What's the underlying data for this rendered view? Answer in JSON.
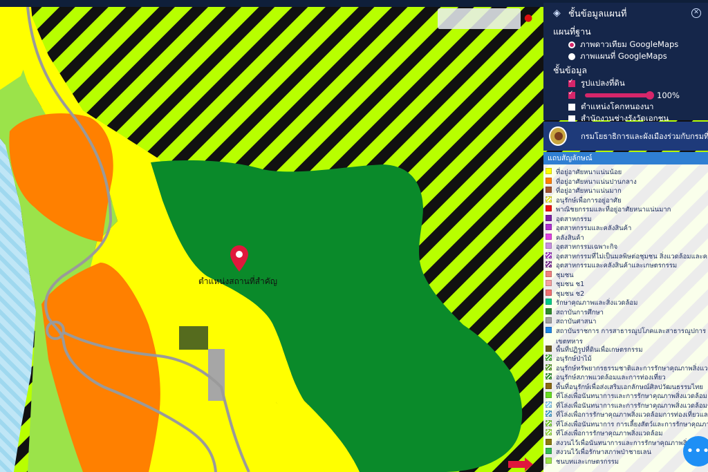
{
  "map": {
    "place_label": "ตำแหน่งสถานที่สำคัญ",
    "colors": {
      "hatch_green": "#b8ff00",
      "hatch_black": "#111111",
      "yellow": "#ffff00",
      "orange": "#ff8000",
      "dark_green": "#0a8a2a",
      "olive": "#556b1e",
      "gray": "#a6a6a6",
      "light_blue": "#9fd8ef",
      "marker": "#e0183c"
    }
  },
  "layer_panel": {
    "title": "ชั้นข้อมูลแผนที่",
    "base_section": "แผนที่ฐาน",
    "base_options": [
      {
        "label": "ภาพดาวเทียม GoogleMaps",
        "selected": true
      },
      {
        "label": "ภาพแผนที่ GoogleMaps",
        "selected": false
      }
    ],
    "layer_section": "ชั้นข้อมูล",
    "layers": [
      {
        "label": "รูปแปลงที่ดิน",
        "checked": true
      },
      {
        "label": "",
        "checked": true,
        "opacity": "100%"
      },
      {
        "label": "ตำแหน่งโคกหนองนา",
        "checked": false
      },
      {
        "label": "สำนักงานช่างรังวัดเอกชน",
        "checked": false
      }
    ]
  },
  "agency": {
    "text": "กรมโยธาธิการและผังเมืองร่วมกับกรมที่ดิน"
  },
  "legend": {
    "title": "แถบสัญลักษณ์",
    "items": [
      {
        "label": "ที่อยู่อาศัยหนาแน่นน้อย",
        "color": "#ffff00",
        "pattern": "solid"
      },
      {
        "label": "ที่อยู่อาศัยหนาแน่นปานกลาง",
        "color": "#ff8000",
        "pattern": "solid"
      },
      {
        "label": "ที่อยู่อาศัยหนาแน่นมาก",
        "color": "#a0522d",
        "pattern": "solid"
      },
      {
        "label": "อนุรักษ์เพื่อการอยู่อาศัย",
        "color": "#e6e620",
        "pattern": "hatch"
      },
      {
        "label": "พาณิชยกรรมและที่อยู่อาศัยหนาแน่นมาก",
        "color": "#ee1111",
        "pattern": "solid"
      },
      {
        "label": "อุตสาหกรรม",
        "color": "#7a1fa2",
        "pattern": "solid"
      },
      {
        "label": "อุตสาหกรรมและคลังสินค้า",
        "color": "#b030d0",
        "pattern": "solid"
      },
      {
        "label": "คลังสินค้า",
        "color": "#e040e0",
        "pattern": "solid"
      },
      {
        "label": "อุตสาหกรรมเฉพาะกิจ",
        "color": "#c890e0",
        "pattern": "solid"
      },
      {
        "label": "อุตสาหกรรมที่ไม่เป็นมลพิษต่อชุมชน สิ่งแวดล้อมและคลังสินค้า",
        "color": "#9b30c0",
        "pattern": "hatch"
      },
      {
        "label": "อุตสาหกรรมและคลังสินค้าและเกษตรกรรม",
        "color": "#7a2a90",
        "pattern": "hatch"
      },
      {
        "label": "ชุมชน",
        "color": "#f08080",
        "pattern": "solid"
      },
      {
        "label": "ชุมชน ช1",
        "color": "#f5a0a0",
        "pattern": "solid"
      },
      {
        "label": "ชุมชน ช2",
        "color": "#f07070",
        "pattern": "solid"
      },
      {
        "label": "รักษาคุณภาพและสิ่งแวดล้อม",
        "color": "#00cc88",
        "pattern": "solid"
      },
      {
        "label": "สถาบันการศึกษา",
        "color": "#2e8b2e",
        "pattern": "solid"
      },
      {
        "label": "สถาบันศาสนา",
        "color": "#a0a0a0",
        "pattern": "solid"
      },
      {
        "label": "สถาบันราชการ การสาธารณูปโภคและสาธารณูปการ เขตทหาร",
        "color": "#1e88e5",
        "pattern": "solid"
      },
      {
        "label": "พื้นที่ปฏิรูปที่ดินเพื่อเกษตรกรรม",
        "color": "#6b5a1e",
        "pattern": "solid"
      },
      {
        "label": "อนุรักษ์ป่าไม้",
        "color": "#40b030",
        "pattern": "hatch"
      },
      {
        "label": "อนุรักษ์ทรัพยากรธรรมชาติและการรักษาคุณภาพสิ่งแวดล้อม",
        "color": "#5aa02a",
        "pattern": "hatch"
      },
      {
        "label": "อนุรักษ์สภาพแวดล้อมและการท่องเที่ยว",
        "color": "#2f8f2f",
        "pattern": "hatch"
      },
      {
        "label": "พื้นที่อนุรักษ์เพื่อส่งเสริมเอกลักษณ์ศิลปวัฒนธรรมไทย",
        "color": "#8a6a10",
        "pattern": "solid"
      },
      {
        "label": "ที่โล่งเพื่อนันทนาการและการรักษาคุณภาพสิ่งแวดล้อม",
        "color": "#66dd22",
        "pattern": "solid"
      },
      {
        "label": "ที่โล่งเพื่อนันทนาการและการรักษาคุณภาพสิ่งแวดล้อมชายฝั่ง",
        "color": "#88ccee",
        "pattern": "hatch"
      },
      {
        "label": "ที่โล่งเพื่อการรักษาคุณภาพสิ่งแวดล้อมการท่องเที่ยวและการป",
        "color": "#4aa0d0",
        "pattern": "hatch"
      },
      {
        "label": "ที่โล่งเพื่อนันทนาการ การเลี้ยงสัตว์และการรักษาคุณภาพสิ่งแ",
        "color": "#77cc33",
        "pattern": "hatch"
      },
      {
        "label": "ที่โล่งเพื่อการรักษาคุณภาพสิ่งแวดล้อม",
        "color": "#99dd44",
        "pattern": "hatch"
      },
      {
        "label": "สงวนไว้เพื่อนันทนาการและการรักษาคุณภาพสิ่งแวดล้อม",
        "color": "#8a7a10",
        "pattern": "solid"
      },
      {
        "label": "สงวนไว้เพื่อรักษาสภาพป่าชายเลน",
        "color": "#33bb55",
        "pattern": "solid"
      },
      {
        "label": "ชนบทและเกษตรกรรม",
        "color": "#9be34a",
        "pattern": "solid"
      }
    ]
  },
  "fab": {
    "label": "•••"
  }
}
